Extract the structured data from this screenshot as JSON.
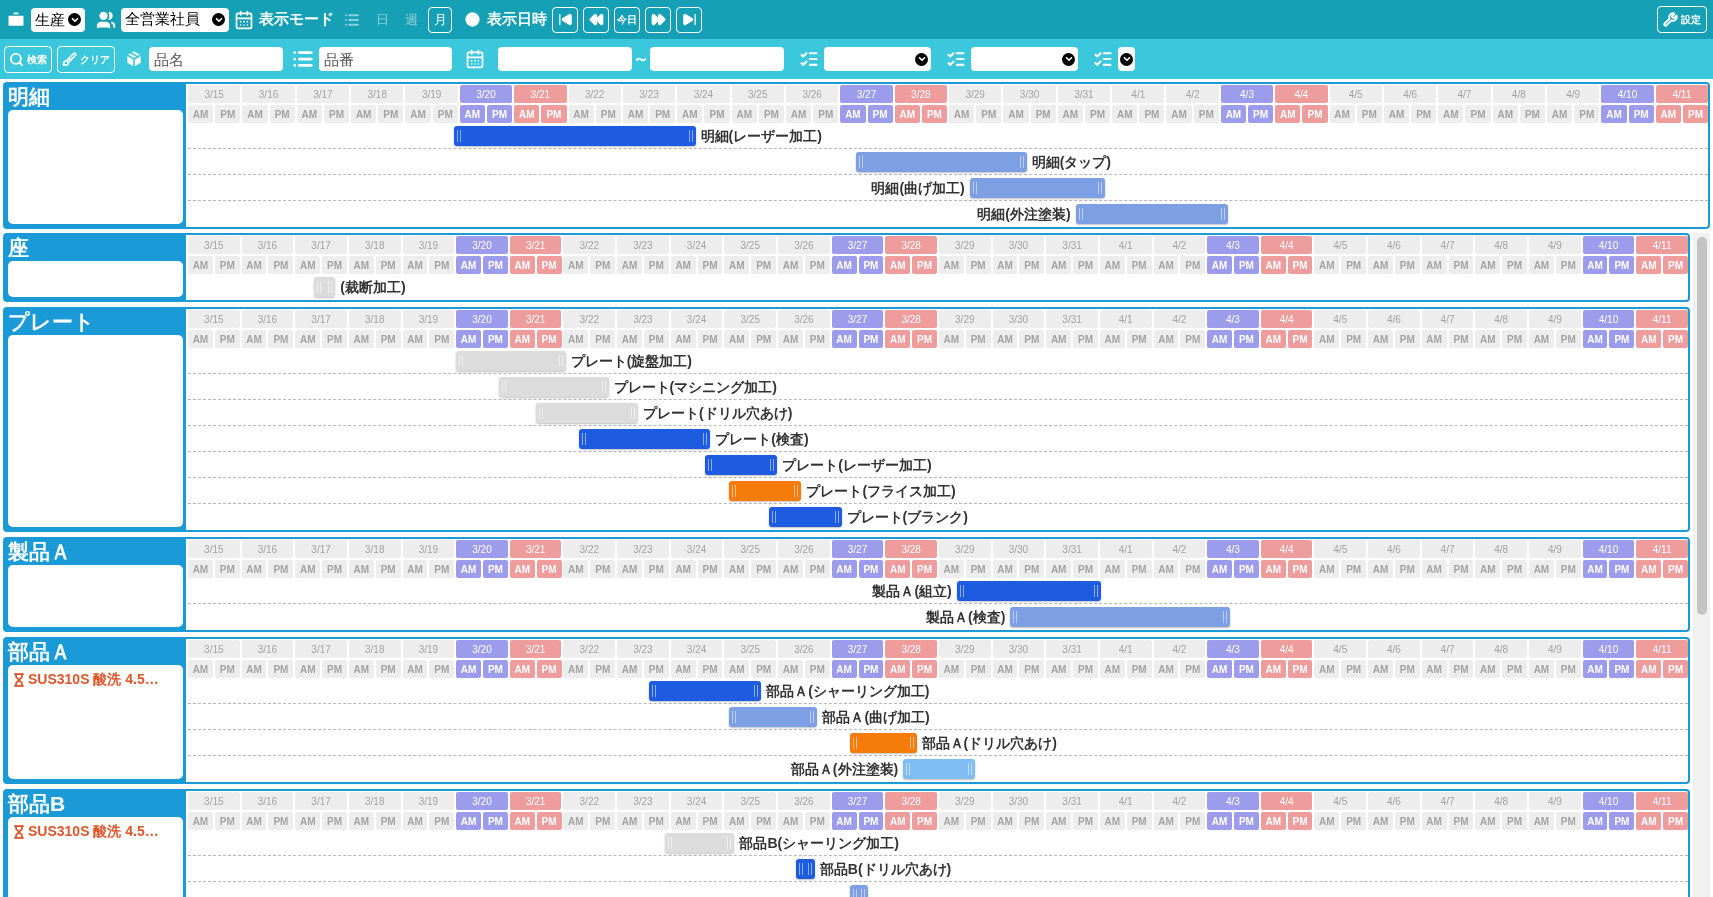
{
  "toolbar": {
    "division_select": {
      "value": "生産"
    },
    "staff_select": {
      "value": "全営業社員"
    },
    "display_mode_label": "表示モード",
    "modes": [
      {
        "kind": "icon",
        "selected": false
      },
      {
        "kind": "text",
        "label": "日",
        "selected": false
      },
      {
        "kind": "text",
        "label": "週",
        "selected": false
      },
      {
        "kind": "text",
        "label": "月",
        "selected": true
      }
    ],
    "display_date_label": "表示日時",
    "nav_buttons": [
      {
        "kind": "first"
      },
      {
        "kind": "prev"
      },
      {
        "kind": "today",
        "label": "今日"
      },
      {
        "kind": "next"
      },
      {
        "kind": "last"
      }
    ],
    "settings_button": {
      "label": "設定"
    }
  },
  "filter_bar": {
    "search_button": {
      "label": "検索"
    },
    "clear_button": {
      "label": "クリア"
    },
    "name_field": {
      "placeholder": "品名"
    },
    "number_field": {
      "placeholder": "品番"
    },
    "date_range": {
      "separator": "～"
    },
    "selects": [
      {
        "kind": "wide"
      },
      {
        "kind": "wide"
      },
      {
        "kind": "narrow"
      }
    ]
  },
  "sections": [
    {
      "title": "明細",
      "days": [
        {
          "date": "3/15",
          "kind": "weekday",
          "am": "AM",
          "pm": "PM"
        },
        {
          "date": "3/16",
          "kind": "weekday",
          "am": "AM",
          "pm": "PM"
        },
        {
          "date": "3/17",
          "kind": "weekday",
          "am": "AM",
          "pm": "PM"
        },
        {
          "date": "3/18",
          "kind": "weekday",
          "am": "AM",
          "pm": "PM"
        },
        {
          "date": "3/19",
          "kind": "weekday",
          "am": "AM",
          "pm": "PM"
        },
        {
          "date": "3/20",
          "kind": "saturday",
          "am": "AM",
          "pm": "PM"
        },
        {
          "date": "3/21",
          "kind": "sunday",
          "am": "AM",
          "pm": "PM"
        },
        {
          "date": "3/22",
          "kind": "weekday",
          "am": "AM",
          "pm": "PM"
        },
        {
          "date": "3/23",
          "kind": "weekday",
          "am": "AM",
          "pm": "PM"
        },
        {
          "date": "3/24",
          "kind": "weekday",
          "am": "AM",
          "pm": "PM"
        },
        {
          "date": "3/25",
          "kind": "weekday",
          "am": "AM",
          "pm": "PM"
        },
        {
          "date": "3/26",
          "kind": "weekday",
          "am": "AM",
          "pm": "PM"
        },
        {
          "date": "3/27",
          "kind": "saturday",
          "am": "AM",
          "pm": "PM"
        },
        {
          "date": "3/28",
          "kind": "sunday",
          "am": "AM",
          "pm": "PM"
        },
        {
          "date": "3/29",
          "kind": "weekday",
          "am": "AM",
          "pm": "PM"
        },
        {
          "date": "3/30",
          "kind": "weekday",
          "am": "AM",
          "pm": "PM"
        },
        {
          "date": "3/31",
          "kind": "weekday",
          "am": "AM",
          "pm": "PM"
        },
        {
          "date": "4/1",
          "kind": "weekday",
          "am": "AM",
          "pm": "PM"
        },
        {
          "date": "4/2",
          "kind": "weekday",
          "am": "AM",
          "pm": "PM"
        },
        {
          "date": "4/3",
          "kind": "saturday",
          "am": "AM",
          "pm": "PM"
        },
        {
          "date": "4/4",
          "kind": "sunday",
          "am": "AM",
          "pm": "PM"
        },
        {
          "date": "4/5",
          "kind": "weekday",
          "am": "AM",
          "pm": "PM"
        },
        {
          "date": "4/6",
          "kind": "weekday",
          "am": "AM",
          "pm": "PM"
        },
        {
          "date": "4/7",
          "kind": "weekday",
          "am": "AM",
          "pm": "PM"
        },
        {
          "date": "4/8",
          "kind": "weekday",
          "am": "AM",
          "pm": "PM"
        },
        {
          "date": "4/9",
          "kind": "weekday",
          "am": "AM",
          "pm": "PM"
        },
        {
          "date": "4/10",
          "kind": "saturday",
          "am": "AM",
          "pm": "PM"
        },
        {
          "date": "4/11",
          "kind": "sunday",
          "am": "AM",
          "pm": "PM"
        }
      ],
      "tasks": [
        {
          "label": "明細(レーザー加工)",
          "color": "#1d5ce0"
        },
        {
          "label": "明細(タップ)",
          "color": "#7d9fe4"
        },
        {
          "label": "明細(曲げ加工)",
          "color": "#7d9fe4"
        },
        {
          "label": "明細(外注塗装)",
          "color": "#7d9fe4"
        }
      ]
    },
    {
      "title": "座",
      "days": [
        {
          "date": "3/15",
          "kind": "weekday",
          "am": "AM",
          "pm": "PM"
        },
        {
          "date": "3/16",
          "kind": "weekday",
          "am": "AM",
          "pm": "PM"
        },
        {
          "date": "3/17",
          "kind": "weekday",
          "am": "AM",
          "pm": "PM"
        },
        {
          "date": "3/18",
          "kind": "weekday",
          "am": "AM",
          "pm": "PM"
        },
        {
          "date": "3/19",
          "kind": "weekday",
          "am": "AM",
          "pm": "PM"
        },
        {
          "date": "3/20",
          "kind": "saturday",
          "am": "AM",
          "pm": "PM"
        },
        {
          "date": "3/21",
          "kind": "sunday",
          "am": "AM",
          "pm": "PM"
        },
        {
          "date": "3/22",
          "kind": "weekday",
          "am": "AM",
          "pm": "PM"
        },
        {
          "date": "3/23",
          "kind": "weekday",
          "am": "AM",
          "pm": "PM"
        },
        {
          "date": "3/24",
          "kind": "weekday",
          "am": "AM",
          "pm": "PM"
        },
        {
          "date": "3/25",
          "kind": "weekday",
          "am": "AM",
          "pm": "PM"
        },
        {
          "date": "3/26",
          "kind": "weekday",
          "am": "AM",
          "pm": "PM"
        },
        {
          "date": "3/27",
          "kind": "saturday",
          "am": "AM",
          "pm": "PM"
        },
        {
          "date": "3/28",
          "kind": "sunday",
          "am": "AM",
          "pm": "PM"
        },
        {
          "date": "3/29",
          "kind": "weekday",
          "am": "AM",
          "pm": "PM"
        },
        {
          "date": "3/30",
          "kind": "weekday",
          "am": "AM",
          "pm": "PM"
        },
        {
          "date": "3/31",
          "kind": "weekday",
          "am": "AM",
          "pm": "PM"
        },
        {
          "date": "4/1",
          "kind": "weekday",
          "am": "AM",
          "pm": "PM"
        },
        {
          "date": "4/2",
          "kind": "weekday",
          "am": "AM",
          "pm": "PM"
        },
        {
          "date": "4/3",
          "kind": "saturday",
          "am": "AM",
          "pm": "PM"
        },
        {
          "date": "4/4",
          "kind": "sunday",
          "am": "AM",
          "pm": "PM"
        },
        {
          "date": "4/5",
          "kind": "weekday",
          "am": "AM",
          "pm": "PM"
        },
        {
          "date": "4/6",
          "kind": "weekday",
          "am": "AM",
          "pm": "PM"
        },
        {
          "date": "4/7",
          "kind": "weekday",
          "am": "AM",
          "pm": "PM"
        },
        {
          "date": "4/8",
          "kind": "weekday",
          "am": "AM",
          "pm": "PM"
        },
        {
          "date": "4/9",
          "kind": "weekday",
          "am": "AM",
          "pm": "PM"
        },
        {
          "date": "4/10",
          "kind": "saturday",
          "am": "AM",
          "pm": "PM"
        },
        {
          "date": "4/11",
          "kind": "sunday",
          "am": "AM",
          "pm": "PM"
        }
      ],
      "tasks": [
        {
          "label": "(裁断加工)",
          "color": "#dcdcdc"
        }
      ]
    },
    {
      "title": "プレート",
      "days": [
        {
          "date": "3/15",
          "kind": "weekday",
          "am": "AM",
          "pm": "PM"
        },
        {
          "date": "3/16",
          "kind": "weekday",
          "am": "AM",
          "pm": "PM"
        },
        {
          "date": "3/17",
          "kind": "weekday",
          "am": "AM",
          "pm": "PM"
        },
        {
          "date": "3/18",
          "kind": "weekday",
          "am": "AM",
          "pm": "PM"
        },
        {
          "date": "3/19",
          "kind": "weekday",
          "am": "AM",
          "pm": "PM"
        },
        {
          "date": "3/20",
          "kind": "saturday",
          "am": "AM",
          "pm": "PM"
        },
        {
          "date": "3/21",
          "kind": "sunday",
          "am": "AM",
          "pm": "PM"
        },
        {
          "date": "3/22",
          "kind": "weekday",
          "am": "AM",
          "pm": "PM"
        },
        {
          "date": "3/23",
          "kind": "weekday",
          "am": "AM",
          "pm": "PM"
        },
        {
          "date": "3/24",
          "kind": "weekday",
          "am": "AM",
          "pm": "PM"
        },
        {
          "date": "3/25",
          "kind": "weekday",
          "am": "AM",
          "pm": "PM"
        },
        {
          "date": "3/26",
          "kind": "weekday",
          "am": "AM",
          "pm": "PM"
        },
        {
          "date": "3/27",
          "kind": "saturday",
          "am": "AM",
          "pm": "PM"
        },
        {
          "date": "3/28",
          "kind": "sunday",
          "am": "AM",
          "pm": "PM"
        },
        {
          "date": "3/29",
          "kind": "weekday",
          "am": "AM",
          "pm": "PM"
        },
        {
          "date": "3/30",
          "kind": "weekday",
          "am": "AM",
          "pm": "PM"
        },
        {
          "date": "3/31",
          "kind": "weekday",
          "am": "AM",
          "pm": "PM"
        },
        {
          "date": "4/1",
          "kind": "weekday",
          "am": "AM",
          "pm": "PM"
        },
        {
          "date": "4/2",
          "kind": "weekday",
          "am": "AM",
          "pm": "PM"
        },
        {
          "date": "4/3",
          "kind": "saturday",
          "am": "AM",
          "pm": "PM"
        },
        {
          "date": "4/4",
          "kind": "sunday",
          "am": "AM",
          "pm": "PM"
        },
        {
          "date": "4/5",
          "kind": "weekday",
          "am": "AM",
          "pm": "PM"
        },
        {
          "date": "4/6",
          "kind": "weekday",
          "am": "AM",
          "pm": "PM"
        },
        {
          "date": "4/7",
          "kind": "weekday",
          "am": "AM",
          "pm": "PM"
        },
        {
          "date": "4/8",
          "kind": "weekday",
          "am": "AM",
          "pm": "PM"
        },
        {
          "date": "4/9",
          "kind": "weekday",
          "am": "AM",
          "pm": "PM"
        },
        {
          "date": "4/10",
          "kind": "saturday",
          "am": "AM",
          "pm": "PM"
        },
        {
          "date": "4/11",
          "kind": "sunday",
          "am": "AM",
          "pm": "PM"
        }
      ],
      "tasks": [
        {
          "label": "プレート(旋盤加工)",
          "color": "#dcdcdc"
        },
        {
          "label": "プレート(マシニング加工)",
          "color": "#dcdcdc"
        },
        {
          "label": "プレート(ドリル穴あけ)",
          "color": "#dcdcdc"
        },
        {
          "label": "プレート(検査)",
          "color": "#1d5ce0"
        },
        {
          "label": "プレート(レーザー加工)",
          "color": "#1d5ce0"
        },
        {
          "label": "プレート(フライス加工)",
          "color": "#f57c0a"
        },
        {
          "label": "プレート(ブランク)",
          "color": "#1d5ce0"
        }
      ]
    },
    {
      "title": "製品Ａ",
      "days": [
        {
          "date": "3/15",
          "kind": "weekday",
          "am": "AM",
          "pm": "PM"
        },
        {
          "date": "3/16",
          "kind": "weekday",
          "am": "AM",
          "pm": "PM"
        },
        {
          "date": "3/17",
          "kind": "weekday",
          "am": "AM",
          "pm": "PM"
        },
        {
          "date": "3/18",
          "kind": "weekday",
          "am": "AM",
          "pm": "PM"
        },
        {
          "date": "3/19",
          "kind": "weekday",
          "am": "AM",
          "pm": "PM"
        },
        {
          "date": "3/20",
          "kind": "saturday",
          "am": "AM",
          "pm": "PM"
        },
        {
          "date": "3/21",
          "kind": "sunday",
          "am": "AM",
          "pm": "PM"
        },
        {
          "date": "3/22",
          "kind": "weekday",
          "am": "AM",
          "pm": "PM"
        },
        {
          "date": "3/23",
          "kind": "weekday",
          "am": "AM",
          "pm": "PM"
        },
        {
          "date": "3/24",
          "kind": "weekday",
          "am": "AM",
          "pm": "PM"
        },
        {
          "date": "3/25",
          "kind": "weekday",
          "am": "AM",
          "pm": "PM"
        },
        {
          "date": "3/26",
          "kind": "weekday",
          "am": "AM",
          "pm": "PM"
        },
        {
          "date": "3/27",
          "kind": "saturday",
          "am": "AM",
          "pm": "PM"
        },
        {
          "date": "3/28",
          "kind": "sunday",
          "am": "AM",
          "pm": "PM"
        },
        {
          "date": "3/29",
          "kind": "weekday",
          "am": "AM",
          "pm": "PM"
        },
        {
          "date": "3/30",
          "kind": "weekday",
          "am": "AM",
          "pm": "PM"
        },
        {
          "date": "3/31",
          "kind": "weekday",
          "am": "AM",
          "pm": "PM"
        },
        {
          "date": "4/1",
          "kind": "weekday",
          "am": "AM",
          "pm": "PM"
        },
        {
          "date": "4/2",
          "kind": "weekday",
          "am": "AM",
          "pm": "PM"
        },
        {
          "date": "4/3",
          "kind": "saturday",
          "am": "AM",
          "pm": "PM"
        },
        {
          "date": "4/4",
          "kind": "sunday",
          "am": "AM",
          "pm": "PM"
        },
        {
          "date": "4/5",
          "kind": "weekday",
          "am": "AM",
          "pm": "PM"
        },
        {
          "date": "4/6",
          "kind": "weekday",
          "am": "AM",
          "pm": "PM"
        },
        {
          "date": "4/7",
          "kind": "weekday",
          "am": "AM",
          "pm": "PM"
        },
        {
          "date": "4/8",
          "kind": "weekday",
          "am": "AM",
          "pm": "PM"
        },
        {
          "date": "4/9",
          "kind": "weekday",
          "am": "AM",
          "pm": "PM"
        },
        {
          "date": "4/10",
          "kind": "saturday",
          "am": "AM",
          "pm": "PM"
        },
        {
          "date": "4/11",
          "kind": "sunday",
          "am": "AM",
          "pm": "PM"
        }
      ],
      "tasks": [
        {
          "label": "製品Ａ(組立)",
          "color": "#1d5ce0"
        },
        {
          "label": "製品Ａ(検査)",
          "color": "#7d9fe4"
        }
      ]
    },
    {
      "title": "部品Ａ",
      "note": "SUS310S 酸洗 4.5…",
      "days": [
        {
          "date": "3/15",
          "kind": "weekday",
          "am": "AM",
          "pm": "PM"
        },
        {
          "date": "3/16",
          "kind": "weekday",
          "am": "AM",
          "pm": "PM"
        },
        {
          "date": "3/17",
          "kind": "weekday",
          "am": "AM",
          "pm": "PM"
        },
        {
          "date": "3/18",
          "kind": "weekday",
          "am": "AM",
          "pm": "PM"
        },
        {
          "date": "3/19",
          "kind": "weekday",
          "am": "AM",
          "pm": "PM"
        },
        {
          "date": "3/20",
          "kind": "saturday",
          "am": "AM",
          "pm": "PM"
        },
        {
          "date": "3/21",
          "kind": "sunday",
          "am": "AM",
          "pm": "PM"
        },
        {
          "date": "3/22",
          "kind": "weekday",
          "am": "AM",
          "pm": "PM"
        },
        {
          "date": "3/23",
          "kind": "weekday",
          "am": "AM",
          "pm": "PM"
        },
        {
          "date": "3/24",
          "kind": "weekday",
          "am": "AM",
          "pm": "PM"
        },
        {
          "date": "3/25",
          "kind": "weekday",
          "am": "AM",
          "pm": "PM"
        },
        {
          "date": "3/26",
          "kind": "weekday",
          "am": "AM",
          "pm": "PM"
        },
        {
          "date": "3/27",
          "kind": "saturday",
          "am": "AM",
          "pm": "PM"
        },
        {
          "date": "3/28",
          "kind": "sunday",
          "am": "AM",
          "pm": "PM"
        },
        {
          "date": "3/29",
          "kind": "weekday",
          "am": "AM",
          "pm": "PM"
        },
        {
          "date": "3/30",
          "kind": "weekday",
          "am": "AM",
          "pm": "PM"
        },
        {
          "date": "3/31",
          "kind": "weekday",
          "am": "AM",
          "pm": "PM"
        },
        {
          "date": "4/1",
          "kind": "weekday",
          "am": "AM",
          "pm": "PM"
        },
        {
          "date": "4/2",
          "kind": "weekday",
          "am": "AM",
          "pm": "PM"
        },
        {
          "date": "4/3",
          "kind": "saturday",
          "am": "AM",
          "pm": "PM"
        },
        {
          "date": "4/4",
          "kind": "sunday",
          "am": "AM",
          "pm": "PM"
        },
        {
          "date": "4/5",
          "kind": "weekday",
          "am": "AM",
          "pm": "PM"
        },
        {
          "date": "4/6",
          "kind": "weekday",
          "am": "AM",
          "pm": "PM"
        },
        {
          "date": "4/7",
          "kind": "weekday",
          "am": "AM",
          "pm": "PM"
        },
        {
          "date": "4/8",
          "kind": "weekday",
          "am": "AM",
          "pm": "PM"
        },
        {
          "date": "4/9",
          "kind": "weekday",
          "am": "AM",
          "pm": "PM"
        },
        {
          "date": "4/10",
          "kind": "saturday",
          "am": "AM",
          "pm": "PM"
        },
        {
          "date": "4/11",
          "kind": "sunday",
          "am": "AM",
          "pm": "PM"
        }
      ],
      "tasks": [
        {
          "label": "部品Ａ(シャーリング加工)",
          "color": "#1d5ce0"
        },
        {
          "label": "部品Ａ(曲げ加工)",
          "color": "#7d9fe4"
        },
        {
          "label": "部品Ａ(ドリル穴あけ)",
          "color": "#f57c0a"
        },
        {
          "label": "部品Ａ(外注塗装)",
          "color": "#80bdf2"
        }
      ]
    },
    {
      "title": "部品B",
      "note": "SUS310S 酸洗 4.5…",
      "days": [
        {
          "date": "3/15",
          "kind": "weekday",
          "am": "AM",
          "pm": "PM"
        },
        {
          "date": "3/16",
          "kind": "weekday",
          "am": "AM",
          "pm": "PM"
        },
        {
          "date": "3/17",
          "kind": "weekday",
          "am": "AM",
          "pm": "PM"
        },
        {
          "date": "3/18",
          "kind": "weekday",
          "am": "AM",
          "pm": "PM"
        },
        {
          "date": "3/19",
          "kind": "weekday",
          "am": "AM",
          "pm": "PM"
        },
        {
          "date": "3/20",
          "kind": "saturday",
          "am": "AM",
          "pm": "PM"
        },
        {
          "date": "3/21",
          "kind": "sunday",
          "am": "AM",
          "pm": "PM"
        },
        {
          "date": "3/22",
          "kind": "weekday",
          "am": "AM",
          "pm": "PM"
        },
        {
          "date": "3/23",
          "kind": "weekday",
          "am": "AM",
          "pm": "PM"
        },
        {
          "date": "3/24",
          "kind": "weekday",
          "am": "AM",
          "pm": "PM"
        },
        {
          "date": "3/25",
          "kind": "weekday",
          "am": "AM",
          "pm": "PM"
        },
        {
          "date": "3/26",
          "kind": "weekday",
          "am": "AM",
          "pm": "PM"
        },
        {
          "date": "3/27",
          "kind": "saturday",
          "am": "AM",
          "pm": "PM"
        },
        {
          "date": "3/28",
          "kind": "sunday",
          "am": "AM",
          "pm": "PM"
        },
        {
          "date": "3/29",
          "kind": "weekday",
          "am": "AM",
          "pm": "PM"
        },
        {
          "date": "3/30",
          "kind": "weekday",
          "am": "AM",
          "pm": "PM"
        },
        {
          "date": "3/31",
          "kind": "weekday",
          "am": "AM",
          "pm": "PM"
        },
        {
          "date": "4/1",
          "kind": "weekday",
          "am": "AM",
          "pm": "PM"
        },
        {
          "date": "4/2",
          "kind": "weekday",
          "am": "AM",
          "pm": "PM"
        },
        {
          "date": "4/3",
          "kind": "saturday",
          "am": "AM",
          "pm": "PM"
        },
        {
          "date": "4/4",
          "kind": "sunday",
          "am": "AM",
          "pm": "PM"
        },
        {
          "date": "4/5",
          "kind": "weekday",
          "am": "AM",
          "pm": "PM"
        },
        {
          "date": "4/6",
          "kind": "weekday",
          "am": "AM",
          "pm": "PM"
        },
        {
          "date": "4/7",
          "kind": "weekday",
          "am": "AM",
          "pm": "PM"
        },
        {
          "date": "4/8",
          "kind": "weekday",
          "am": "AM",
          "pm": "PM"
        },
        {
          "date": "4/9",
          "kind": "weekday",
          "am": "AM",
          "pm": "PM"
        },
        {
          "date": "4/10",
          "kind": "saturday",
          "am": "AM",
          "pm": "PM"
        },
        {
          "date": "4/11",
          "kind": "sunday",
          "am": "AM",
          "pm": "PM"
        }
      ],
      "tasks": [
        {
          "label": "部品B(シャーリング加工)",
          "color": "#dcdcdc"
        },
        {
          "label": "部品B(ドリル穴あけ)",
          "color": "#1d5ce0"
        },
        {
          "color": "#7d9fe4"
        }
      ]
    }
  ]
}
